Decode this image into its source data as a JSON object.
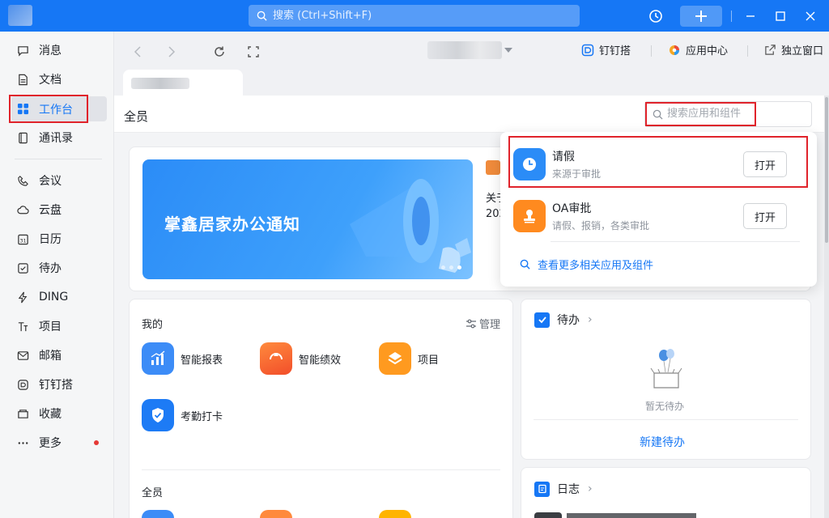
{
  "titlebar": {
    "search_placeholder": "搜索 (Ctrl+Shift+F)"
  },
  "sidebar": {
    "items": [
      {
        "label": "消息",
        "icon": "message-icon"
      },
      {
        "label": "文档",
        "icon": "document-icon"
      },
      {
        "label": "工作台",
        "icon": "workbench-icon",
        "active": true
      },
      {
        "label": "通讯录",
        "icon": "contacts-icon"
      },
      {
        "label": "会议",
        "icon": "meeting-icon"
      },
      {
        "label": "云盘",
        "icon": "cloud-icon"
      },
      {
        "label": "日历",
        "icon": "calendar-icon"
      },
      {
        "label": "待办",
        "icon": "todo-icon"
      },
      {
        "label": "DING",
        "icon": "ding-icon"
      },
      {
        "label": "项目",
        "icon": "project-icon"
      },
      {
        "label": "邮箱",
        "icon": "mail-icon"
      },
      {
        "label": "钉钉搭",
        "icon": "dingda-icon"
      },
      {
        "label": "收藏",
        "icon": "favorites-icon"
      },
      {
        "label": "更多",
        "icon": "more-icon"
      }
    ]
  },
  "chrome": {
    "dingda": "钉钉搭",
    "app_center": "应用中心",
    "standalone": "独立窗口"
  },
  "header": {
    "title": "全员",
    "search_placeholder": "搜索应用和组件"
  },
  "banner": {
    "text": "掌鑫居家办公通知",
    "side_text_1": "关于",
    "side_text_2": "202"
  },
  "mine": {
    "title": "我的",
    "manage": "管理",
    "apps": [
      "智能报表",
      "智能绩效",
      "项目",
      "考勤打卡"
    ]
  },
  "all_members": {
    "title": "全员"
  },
  "todo": {
    "title": "待办",
    "empty": "暂无待办",
    "new": "新建待办"
  },
  "log": {
    "title": "日志"
  },
  "dropdown": {
    "results": [
      {
        "name": "请假",
        "desc": "来源于审批",
        "action": "打开"
      },
      {
        "name": "OA审批",
        "desc": "请假、报销，各类审批",
        "action": "打开"
      }
    ],
    "more": "查看更多相关应用及组件"
  },
  "colors": {
    "accent": "#1677f5",
    "highlight": "#e0232b"
  }
}
